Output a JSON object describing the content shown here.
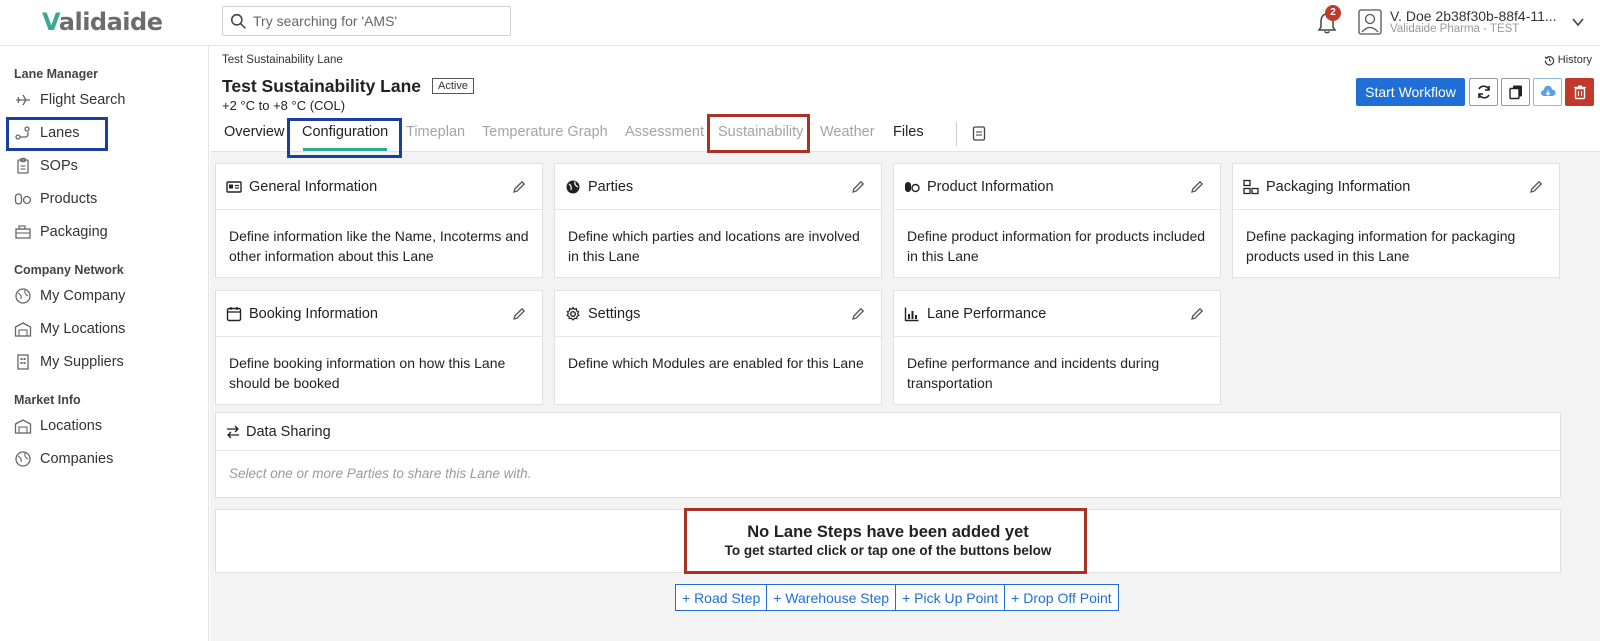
{
  "header": {
    "logo": "alidaide",
    "logo_mark": "V",
    "search_placeholder": "Try searching for 'AMS'",
    "notification_count": "2",
    "user_name": "V. Doe 2b38f30b-88f4-11...",
    "user_org": "Validaide Pharma - TEST"
  },
  "sidebar": {
    "sections": [
      {
        "heading": "Lane Manager",
        "items": [
          "Flight Search",
          "Lanes",
          "SOPs",
          "Products",
          "Packaging"
        ]
      },
      {
        "heading": "Company Network",
        "items": [
          "My Company",
          "My Locations",
          "My Suppliers"
        ]
      },
      {
        "heading": "Market Info",
        "items": [
          "Locations",
          "Companies"
        ]
      }
    ]
  },
  "page": {
    "breadcrumb": "Test Sustainability Lane",
    "history_label": "History",
    "title": "Test Sustainability Lane",
    "status": "Active",
    "temperature_range": "+2 °C to +8 °C (COL)",
    "start_workflow": "Start Workflow"
  },
  "tabs": [
    "Overview",
    "Configuration",
    "Timeplan",
    "Temperature Graph",
    "Assessment",
    "Sustainability",
    "Weather",
    "Files"
  ],
  "active_tab": "Configuration",
  "cards": [
    {
      "title": "General Information",
      "body": "Define information like the Name, Incoterms and other information about this Lane"
    },
    {
      "title": "Parties",
      "body": "Define which parties and locations are involved in this Lane"
    },
    {
      "title": "Product Information",
      "body": "Define product information for products included in this Lane"
    },
    {
      "title": "Packaging Information",
      "body": "Define packaging information for packaging products used in this Lane"
    },
    {
      "title": "Booking Information",
      "body": "Define booking information on how this Lane should be booked"
    },
    {
      "title": "Settings",
      "body": "Define which Modules are enabled for this Lane"
    },
    {
      "title": "Lane Performance",
      "body": "Define performance and incidents during transportation"
    }
  ],
  "data_sharing": {
    "title": "Data Sharing",
    "hint": "Select one or more Parties to share this Lane with."
  },
  "lane_steps": {
    "empty_title": "No Lane Steps have been added yet",
    "empty_subtitle": "To get started click or tap one of the buttons below",
    "buttons": [
      "+ Road Step",
      "+ Warehouse Step",
      "+ Pick Up Point",
      "+ Drop Off Point"
    ]
  },
  "colors": {
    "primary": "#1f6fd6",
    "accent_teal": "#2ea797",
    "highlight_blue": "#1a3f9e",
    "highlight_red": "#a83224",
    "danger": "#c0392b"
  }
}
